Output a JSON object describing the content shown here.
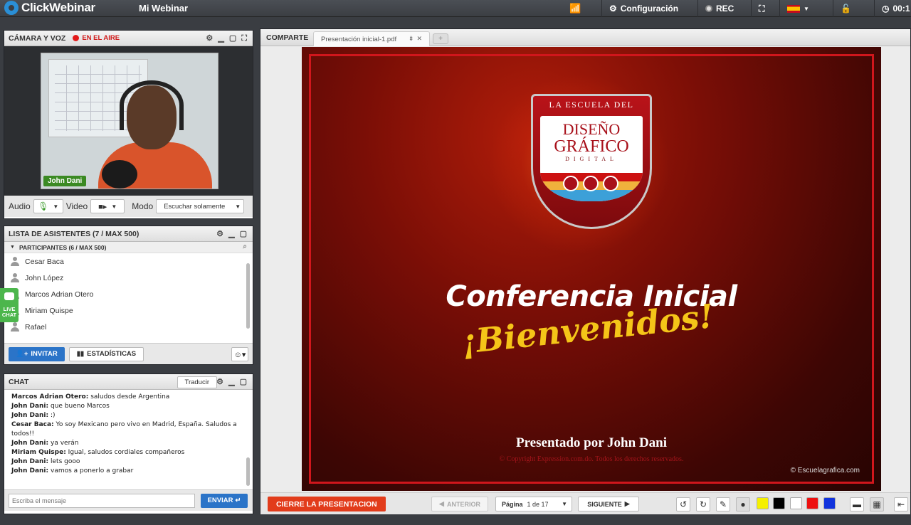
{
  "topbar": {
    "logo_text": "ClickWebinar",
    "title": "Mi Webinar",
    "settings_label": "Configuración",
    "rec_label": "REC",
    "clock": "00:1"
  },
  "camera_panel": {
    "title": "CÁMARA Y VOZ",
    "on_air": "EN EL AIRE",
    "presenter_name": "John Dani",
    "audio_label": "Audio",
    "video_label": "Video",
    "mode_label": "Modo",
    "mode_value": "Escuchar solamente"
  },
  "attendees_panel": {
    "title": "LISTA DE ASISTENTES (7 / MAX 500)",
    "participants_header": "PARTICIPANTES (6 / MAX 500)",
    "participants": [
      {
        "name": "Cesar Baca"
      },
      {
        "name": "John López"
      },
      {
        "name": "Marcos Adrian Otero"
      },
      {
        "name": "Miriam Quispe"
      },
      {
        "name": "Rafael"
      }
    ],
    "invite_label": "INVITAR",
    "stats_label": "ESTADÍSTICAS"
  },
  "live_chat_tab": {
    "line1": "LIVE",
    "line2": "CHAT"
  },
  "chat_panel": {
    "title": "CHAT",
    "translate_label": "Traducir",
    "messages": [
      {
        "author": "Marcos Adrian Otero:",
        "text": "saludos desde Argentina"
      },
      {
        "author": "John Dani:",
        "text": "que bueno Marcos"
      },
      {
        "author": "John Dani:",
        "text": ":)"
      },
      {
        "author": "Cesar Baca:",
        "text": "Yo soy Mexicano pero vivo en Madrid, España. Saludos a todos!!"
      },
      {
        "author": "John Dani:",
        "text": "ya verán"
      },
      {
        "author": "Miriam Quispe:",
        "text": "Igual, saludos cordiales compañeros"
      },
      {
        "author": "John Dani:",
        "text": "lets gooo"
      },
      {
        "author": "John Dani:",
        "text": "vamos a ponerlo a grabar"
      }
    ],
    "input_placeholder": "Escriba el mensaje",
    "send_label": "ENVIAR"
  },
  "presentation_panel": {
    "label": "COMPARTE",
    "file_tab": "Presentación inicial-1.pdf",
    "slide": {
      "shield_top": "LA ESCUELA DEL",
      "shield_line1": "DISEÑO",
      "shield_line2": "GRÁFICO",
      "shield_line3": "DIGITAL",
      "title": "Conferencia Inicial",
      "welcome": "¡Bienvenidos!",
      "presenter": "Presentado por John Dani",
      "copyright": "© Copyright Expression.com.do. Todos los derechos reservados.",
      "site": "© Escuelagrafica.com"
    },
    "close_label": "CIERRE LA PRESENTACION",
    "prev_label": "ANTERIOR",
    "page_label": "Página",
    "page_value": "1 de 17",
    "next_label": "SIGUIENTE",
    "colors": [
      "#1a1a1a",
      "#f5f000",
      "#000000",
      "#ffffff",
      "#ee1111",
      "#1133dd"
    ]
  }
}
